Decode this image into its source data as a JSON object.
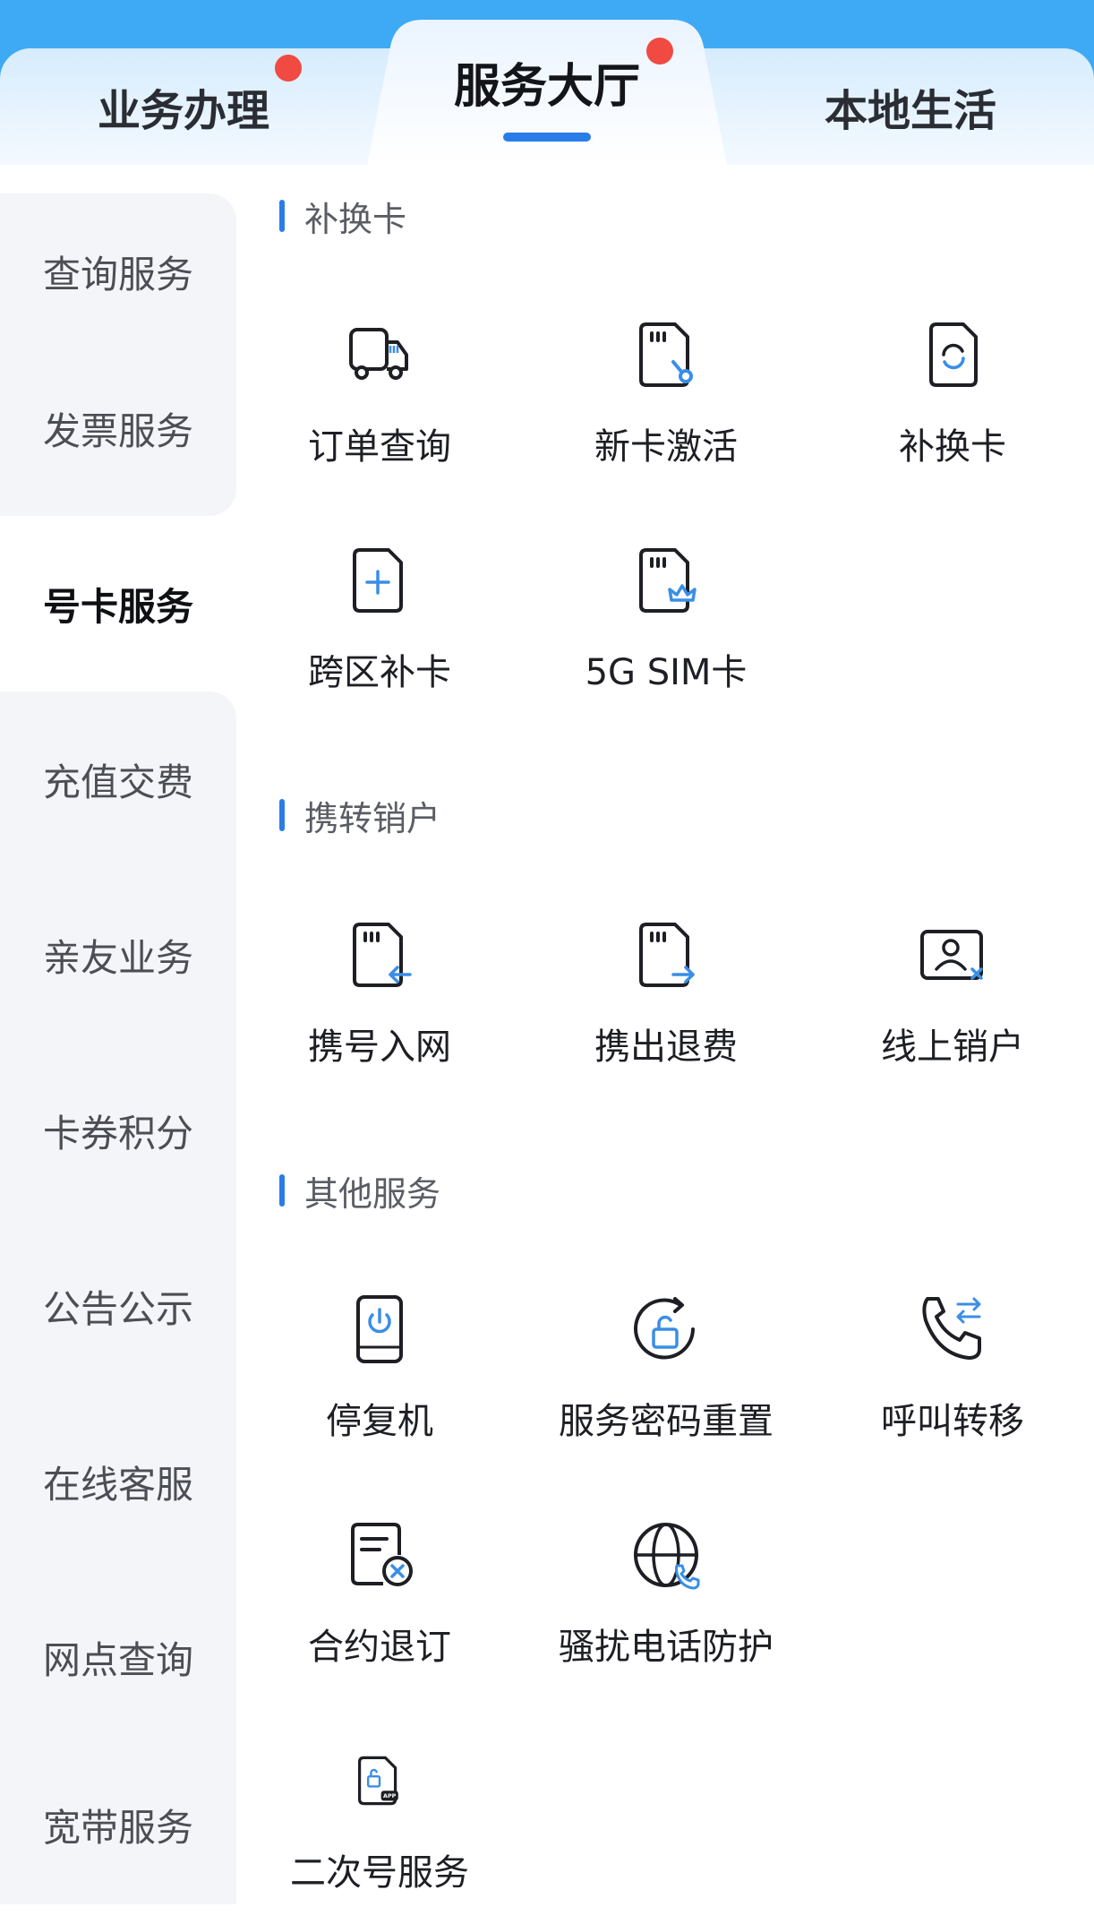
{
  "tabs": {
    "business": "业务办理",
    "hall": "服务大厅",
    "local": "本地生活"
  },
  "sidebar": {
    "items": [
      {
        "label": "查询服务"
      },
      {
        "label": "发票服务"
      },
      {
        "label": "号卡服务"
      },
      {
        "label": "充值交费"
      },
      {
        "label": "亲友业务"
      },
      {
        "label": "卡券积分"
      },
      {
        "label": "公告公示"
      },
      {
        "label": "在线客服"
      },
      {
        "label": "网点查询"
      },
      {
        "label": "宽带服务"
      }
    ],
    "active_index": 2
  },
  "sections": {
    "card": {
      "title": "补换卡",
      "items": [
        "订单查询",
        "新卡激活",
        "补换卡",
        "跨区补卡",
        "5G SIM卡"
      ]
    },
    "transfer": {
      "title": "携转销户",
      "items": [
        "携号入网",
        "携出退费",
        "线上销户"
      ]
    },
    "other": {
      "title": "其他服务",
      "items": [
        "停复机",
        "服务密码重置",
        "呼叫转移",
        "合约退订",
        "骚扰电话防护",
        "二次号服务"
      ]
    }
  },
  "colors": {
    "accent": "#2a7de9",
    "header_blue": "#3ea9f4",
    "badge_red": "#f04a43",
    "icon_dark": "#1d1f24",
    "icon_blue": "#3a8ee6"
  }
}
